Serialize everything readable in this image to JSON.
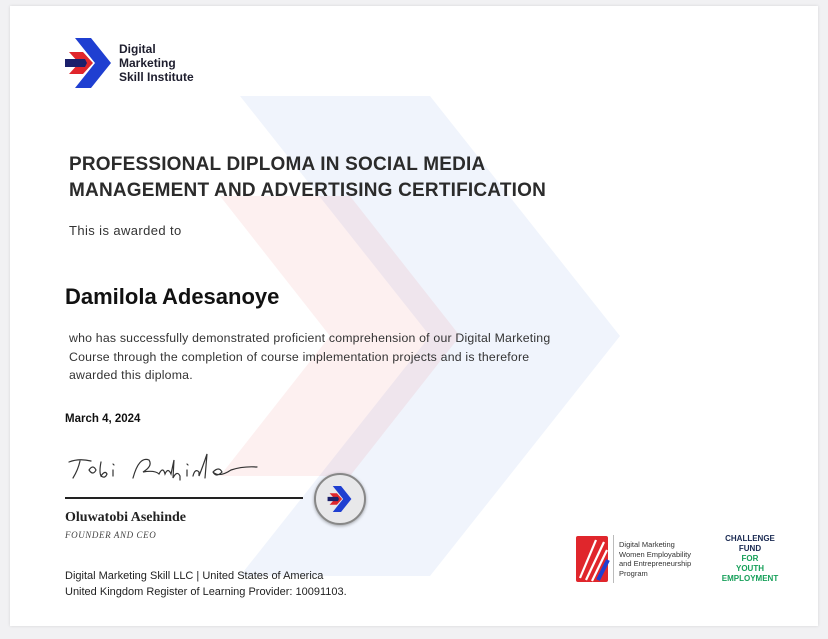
{
  "institute": {
    "name_lines": [
      "Digital",
      "Marketing",
      "Skill Institute"
    ],
    "icon": "chevron-logo-icon",
    "colors": {
      "blue": "#1f3fd1",
      "red": "#e0262c",
      "navy": "#1a1f6b"
    }
  },
  "certificate": {
    "title_lines": [
      "PROFESSIONAL DIPLOMA IN SOCIAL MEDIA",
      "MANAGEMENT AND ADVERTISING CERTIFICATION"
    ],
    "awarded_text": "This is awarded to",
    "recipient": "Damilola Adesanoye",
    "description_lines": [
      "who has successfully demonstrated proficient comprehension of our Digital Marketing",
      "Course through the completion of course implementation projects and is therefore",
      "awarded this diploma."
    ],
    "date": "March 4, 2024"
  },
  "signatory": {
    "name": "Oluwatobi Asehinde",
    "role": "FOUNDER AND CEO",
    "signature_icon": "handwritten-signature-icon",
    "seal_icon": "institute-seal-icon"
  },
  "footer": {
    "lines": [
      "Digital Marketing Skill LLC  | United States of America",
      "United Kingdom  Register of Learning Provider: 10091103."
    ]
  },
  "partners": {
    "program_icon": "program-logo-icon",
    "program_lines": [
      "Digital Marketing",
      "Women Employability",
      "and Entrepreneurship",
      "Program"
    ],
    "fund_lines": [
      "CHALLENGE",
      "FUND",
      "FOR",
      "YOUTH",
      "EMPLOYMENT"
    ],
    "fund_colors": {
      "primary": "#1a2a52",
      "accent": "#17a05a"
    }
  }
}
